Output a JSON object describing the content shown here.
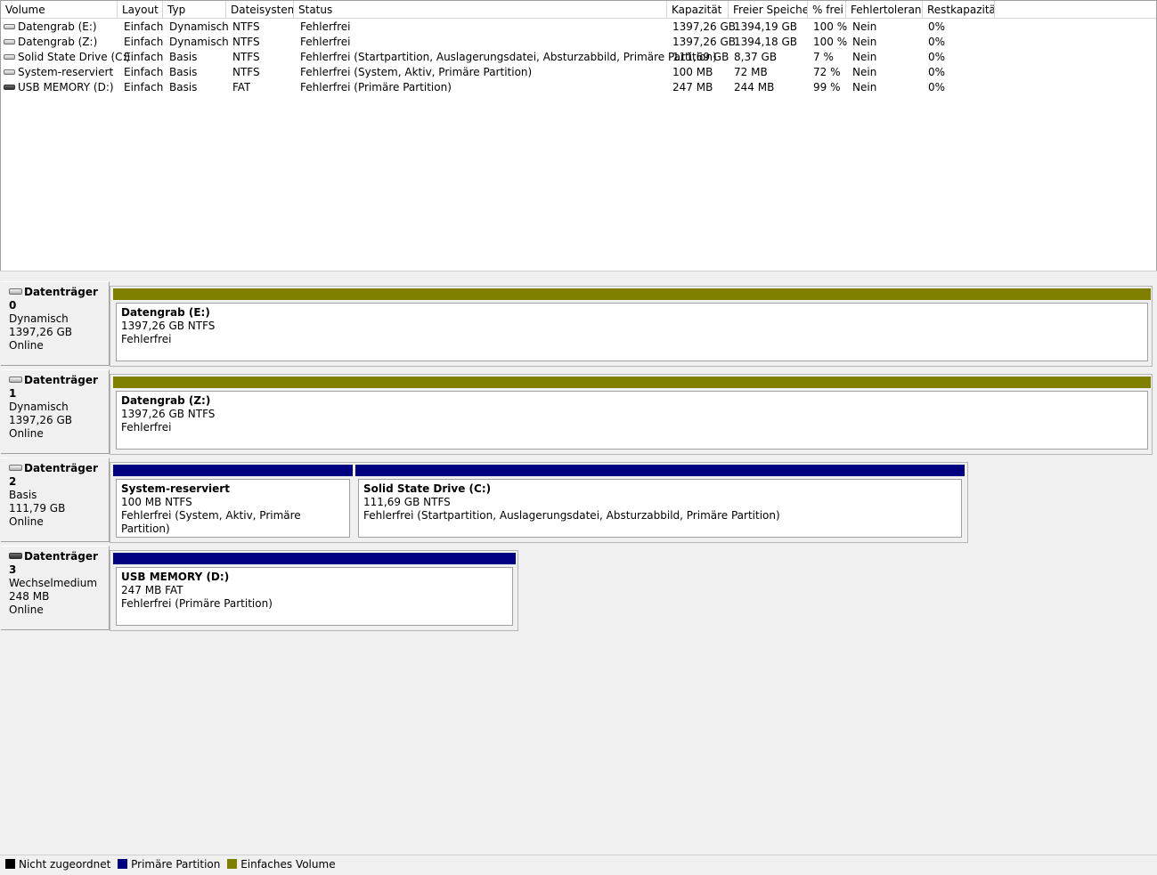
{
  "colors": {
    "primary": "#000080",
    "simple": "#808000",
    "unallocated": "#000000"
  },
  "volume_list": {
    "columns": [
      "Volume",
      "Layout",
      "Typ",
      "Dateisystem",
      "Status",
      "Kapazität",
      "Freier Speicher",
      "% frei",
      "Fehlertoleranz",
      "Restkapazität"
    ],
    "rows": [
      {
        "icon": "hdd-icon",
        "volume": "Datengrab (E:)",
        "layout": "Einfach",
        "typ": "Dynamisch",
        "fs": "NTFS",
        "status": "Fehlerfrei",
        "kap": "1397,26 GB",
        "frei": "1394,19 GB",
        "pct": "100 %",
        "ft": "Nein",
        "rest": "0%"
      },
      {
        "icon": "hdd-icon",
        "volume": "Datengrab (Z:)",
        "layout": "Einfach",
        "typ": "Dynamisch",
        "fs": "NTFS",
        "status": "Fehlerfrei",
        "kap": "1397,26 GB",
        "frei": "1394,18 GB",
        "pct": "100 %",
        "ft": "Nein",
        "rest": "0%"
      },
      {
        "icon": "hdd-icon",
        "volume": "Solid State Drive (C:)",
        "layout": "Einfach",
        "typ": "Basis",
        "fs": "NTFS",
        "status": "Fehlerfrei (Startpartition, Auslagerungsdatei, Absturzabbild, Primäre Partition)",
        "kap": "111,69 GB",
        "frei": "8,37 GB",
        "pct": "7 %",
        "ft": "Nein",
        "rest": "0%"
      },
      {
        "icon": "hdd-icon",
        "volume": "System-reserviert",
        "layout": "Einfach",
        "typ": "Basis",
        "fs": "NTFS",
        "status": "Fehlerfrei (System, Aktiv, Primäre Partition)",
        "kap": "100 MB",
        "frei": "72 MB",
        "pct": "72 %",
        "ft": "Nein",
        "rest": "0%"
      },
      {
        "icon": "usb-drive-icon",
        "volume": "USB MEMORY (D:)",
        "layout": "Einfach",
        "typ": "Basis",
        "fs": "FAT",
        "status": "Fehlerfrei (Primäre Partition)",
        "kap": "247 MB",
        "frei": "244 MB",
        "pct": "99 %",
        "ft": "Nein",
        "rest": "0%"
      }
    ]
  },
  "disks": [
    {
      "title": "Datenträger 0",
      "type": "Dynamisch",
      "size": "1397,26 GB",
      "state": "Online",
      "icon": "hdd-icon",
      "partitions": [
        {
          "name": "Datengrab  (E:)",
          "size_fs": "1397,26 GB NTFS",
          "status": "Fehlerfrei",
          "kind": "simple"
        }
      ]
    },
    {
      "title": "Datenträger 1",
      "type": "Dynamisch",
      "size": "1397,26 GB",
      "state": "Online",
      "icon": "hdd-icon",
      "partitions": [
        {
          "name": "Datengrab  (Z:)",
          "size_fs": "1397,26 GB NTFS",
          "status": "Fehlerfrei",
          "kind": "simple"
        }
      ]
    },
    {
      "title": "Datenträger 2",
      "type": "Basis",
      "size": "111,79 GB",
      "state": "Online",
      "icon": "hdd-icon",
      "partitions": [
        {
          "name": "System-reserviert",
          "size_fs": "100 MB NTFS",
          "status": "Fehlerfrei (System, Aktiv, Primäre Partition)",
          "kind": "primary"
        },
        {
          "name": "Solid State Drive  (C:)",
          "size_fs": "111,69 GB NTFS",
          "status": "Fehlerfrei (Startpartition, Auslagerungsdatei, Absturzabbild, Primäre Partition)",
          "kind": "primary"
        }
      ]
    },
    {
      "title": "Datenträger 3",
      "type": "Wechselmedium",
      "size": "248 MB",
      "state": "Online",
      "icon": "usb-drive-icon",
      "partitions": [
        {
          "name": "USB MEMORY  (D:)",
          "size_fs": "247 MB FAT",
          "status": "Fehlerfrei (Primäre Partition)",
          "kind": "primary"
        }
      ]
    }
  ],
  "legend": [
    {
      "label": "Nicht zugeordnet",
      "kind": "unallocated"
    },
    {
      "label": "Primäre Partition",
      "kind": "primary"
    },
    {
      "label": "Einfaches Volume",
      "kind": "simple"
    }
  ]
}
